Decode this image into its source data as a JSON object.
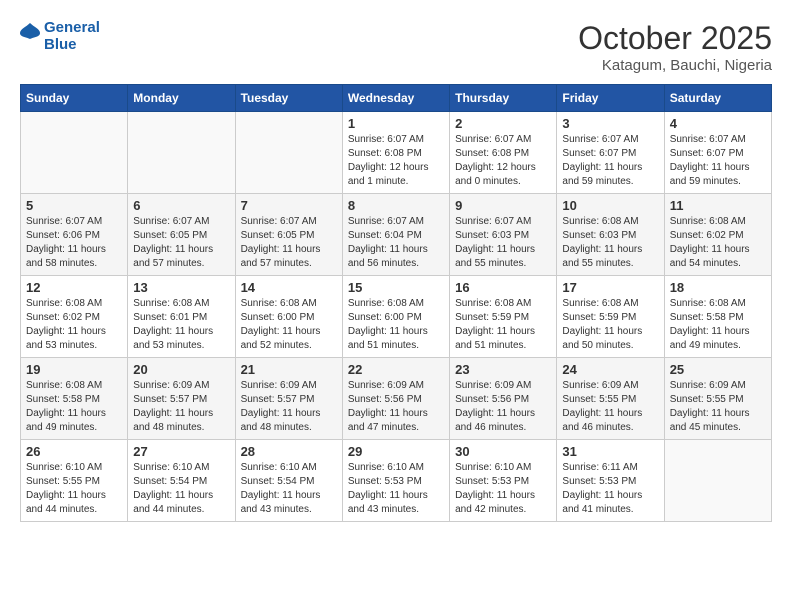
{
  "logo": {
    "text_general": "General",
    "text_blue": "Blue"
  },
  "header": {
    "title": "October 2025",
    "subtitle": "Katagum, Bauchi, Nigeria"
  },
  "weekdays": [
    "Sunday",
    "Monday",
    "Tuesday",
    "Wednesday",
    "Thursday",
    "Friday",
    "Saturday"
  ],
  "weeks": [
    [
      {
        "day": "",
        "info": ""
      },
      {
        "day": "",
        "info": ""
      },
      {
        "day": "",
        "info": ""
      },
      {
        "day": "1",
        "info": "Sunrise: 6:07 AM\nSunset: 6:08 PM\nDaylight: 12 hours\nand 1 minute."
      },
      {
        "day": "2",
        "info": "Sunrise: 6:07 AM\nSunset: 6:08 PM\nDaylight: 12 hours\nand 0 minutes."
      },
      {
        "day": "3",
        "info": "Sunrise: 6:07 AM\nSunset: 6:07 PM\nDaylight: 11 hours\nand 59 minutes."
      },
      {
        "day": "4",
        "info": "Sunrise: 6:07 AM\nSunset: 6:07 PM\nDaylight: 11 hours\nand 59 minutes."
      }
    ],
    [
      {
        "day": "5",
        "info": "Sunrise: 6:07 AM\nSunset: 6:06 PM\nDaylight: 11 hours\nand 58 minutes."
      },
      {
        "day": "6",
        "info": "Sunrise: 6:07 AM\nSunset: 6:05 PM\nDaylight: 11 hours\nand 57 minutes."
      },
      {
        "day": "7",
        "info": "Sunrise: 6:07 AM\nSunset: 6:05 PM\nDaylight: 11 hours\nand 57 minutes."
      },
      {
        "day": "8",
        "info": "Sunrise: 6:07 AM\nSunset: 6:04 PM\nDaylight: 11 hours\nand 56 minutes."
      },
      {
        "day": "9",
        "info": "Sunrise: 6:07 AM\nSunset: 6:03 PM\nDaylight: 11 hours\nand 55 minutes."
      },
      {
        "day": "10",
        "info": "Sunrise: 6:08 AM\nSunset: 6:03 PM\nDaylight: 11 hours\nand 55 minutes."
      },
      {
        "day": "11",
        "info": "Sunrise: 6:08 AM\nSunset: 6:02 PM\nDaylight: 11 hours\nand 54 minutes."
      }
    ],
    [
      {
        "day": "12",
        "info": "Sunrise: 6:08 AM\nSunset: 6:02 PM\nDaylight: 11 hours\nand 53 minutes."
      },
      {
        "day": "13",
        "info": "Sunrise: 6:08 AM\nSunset: 6:01 PM\nDaylight: 11 hours\nand 53 minutes."
      },
      {
        "day": "14",
        "info": "Sunrise: 6:08 AM\nSunset: 6:00 PM\nDaylight: 11 hours\nand 52 minutes."
      },
      {
        "day": "15",
        "info": "Sunrise: 6:08 AM\nSunset: 6:00 PM\nDaylight: 11 hours\nand 51 minutes."
      },
      {
        "day": "16",
        "info": "Sunrise: 6:08 AM\nSunset: 5:59 PM\nDaylight: 11 hours\nand 51 minutes."
      },
      {
        "day": "17",
        "info": "Sunrise: 6:08 AM\nSunset: 5:59 PM\nDaylight: 11 hours\nand 50 minutes."
      },
      {
        "day": "18",
        "info": "Sunrise: 6:08 AM\nSunset: 5:58 PM\nDaylight: 11 hours\nand 49 minutes."
      }
    ],
    [
      {
        "day": "19",
        "info": "Sunrise: 6:08 AM\nSunset: 5:58 PM\nDaylight: 11 hours\nand 49 minutes."
      },
      {
        "day": "20",
        "info": "Sunrise: 6:09 AM\nSunset: 5:57 PM\nDaylight: 11 hours\nand 48 minutes."
      },
      {
        "day": "21",
        "info": "Sunrise: 6:09 AM\nSunset: 5:57 PM\nDaylight: 11 hours\nand 48 minutes."
      },
      {
        "day": "22",
        "info": "Sunrise: 6:09 AM\nSunset: 5:56 PM\nDaylight: 11 hours\nand 47 minutes."
      },
      {
        "day": "23",
        "info": "Sunrise: 6:09 AM\nSunset: 5:56 PM\nDaylight: 11 hours\nand 46 minutes."
      },
      {
        "day": "24",
        "info": "Sunrise: 6:09 AM\nSunset: 5:55 PM\nDaylight: 11 hours\nand 46 minutes."
      },
      {
        "day": "25",
        "info": "Sunrise: 6:09 AM\nSunset: 5:55 PM\nDaylight: 11 hours\nand 45 minutes."
      }
    ],
    [
      {
        "day": "26",
        "info": "Sunrise: 6:10 AM\nSunset: 5:55 PM\nDaylight: 11 hours\nand 44 minutes."
      },
      {
        "day": "27",
        "info": "Sunrise: 6:10 AM\nSunset: 5:54 PM\nDaylight: 11 hours\nand 44 minutes."
      },
      {
        "day": "28",
        "info": "Sunrise: 6:10 AM\nSunset: 5:54 PM\nDaylight: 11 hours\nand 43 minutes."
      },
      {
        "day": "29",
        "info": "Sunrise: 6:10 AM\nSunset: 5:53 PM\nDaylight: 11 hours\nand 43 minutes."
      },
      {
        "day": "30",
        "info": "Sunrise: 6:10 AM\nSunset: 5:53 PM\nDaylight: 11 hours\nand 42 minutes."
      },
      {
        "day": "31",
        "info": "Sunrise: 6:11 AM\nSunset: 5:53 PM\nDaylight: 11 hours\nand 41 minutes."
      },
      {
        "day": "",
        "info": ""
      }
    ]
  ]
}
